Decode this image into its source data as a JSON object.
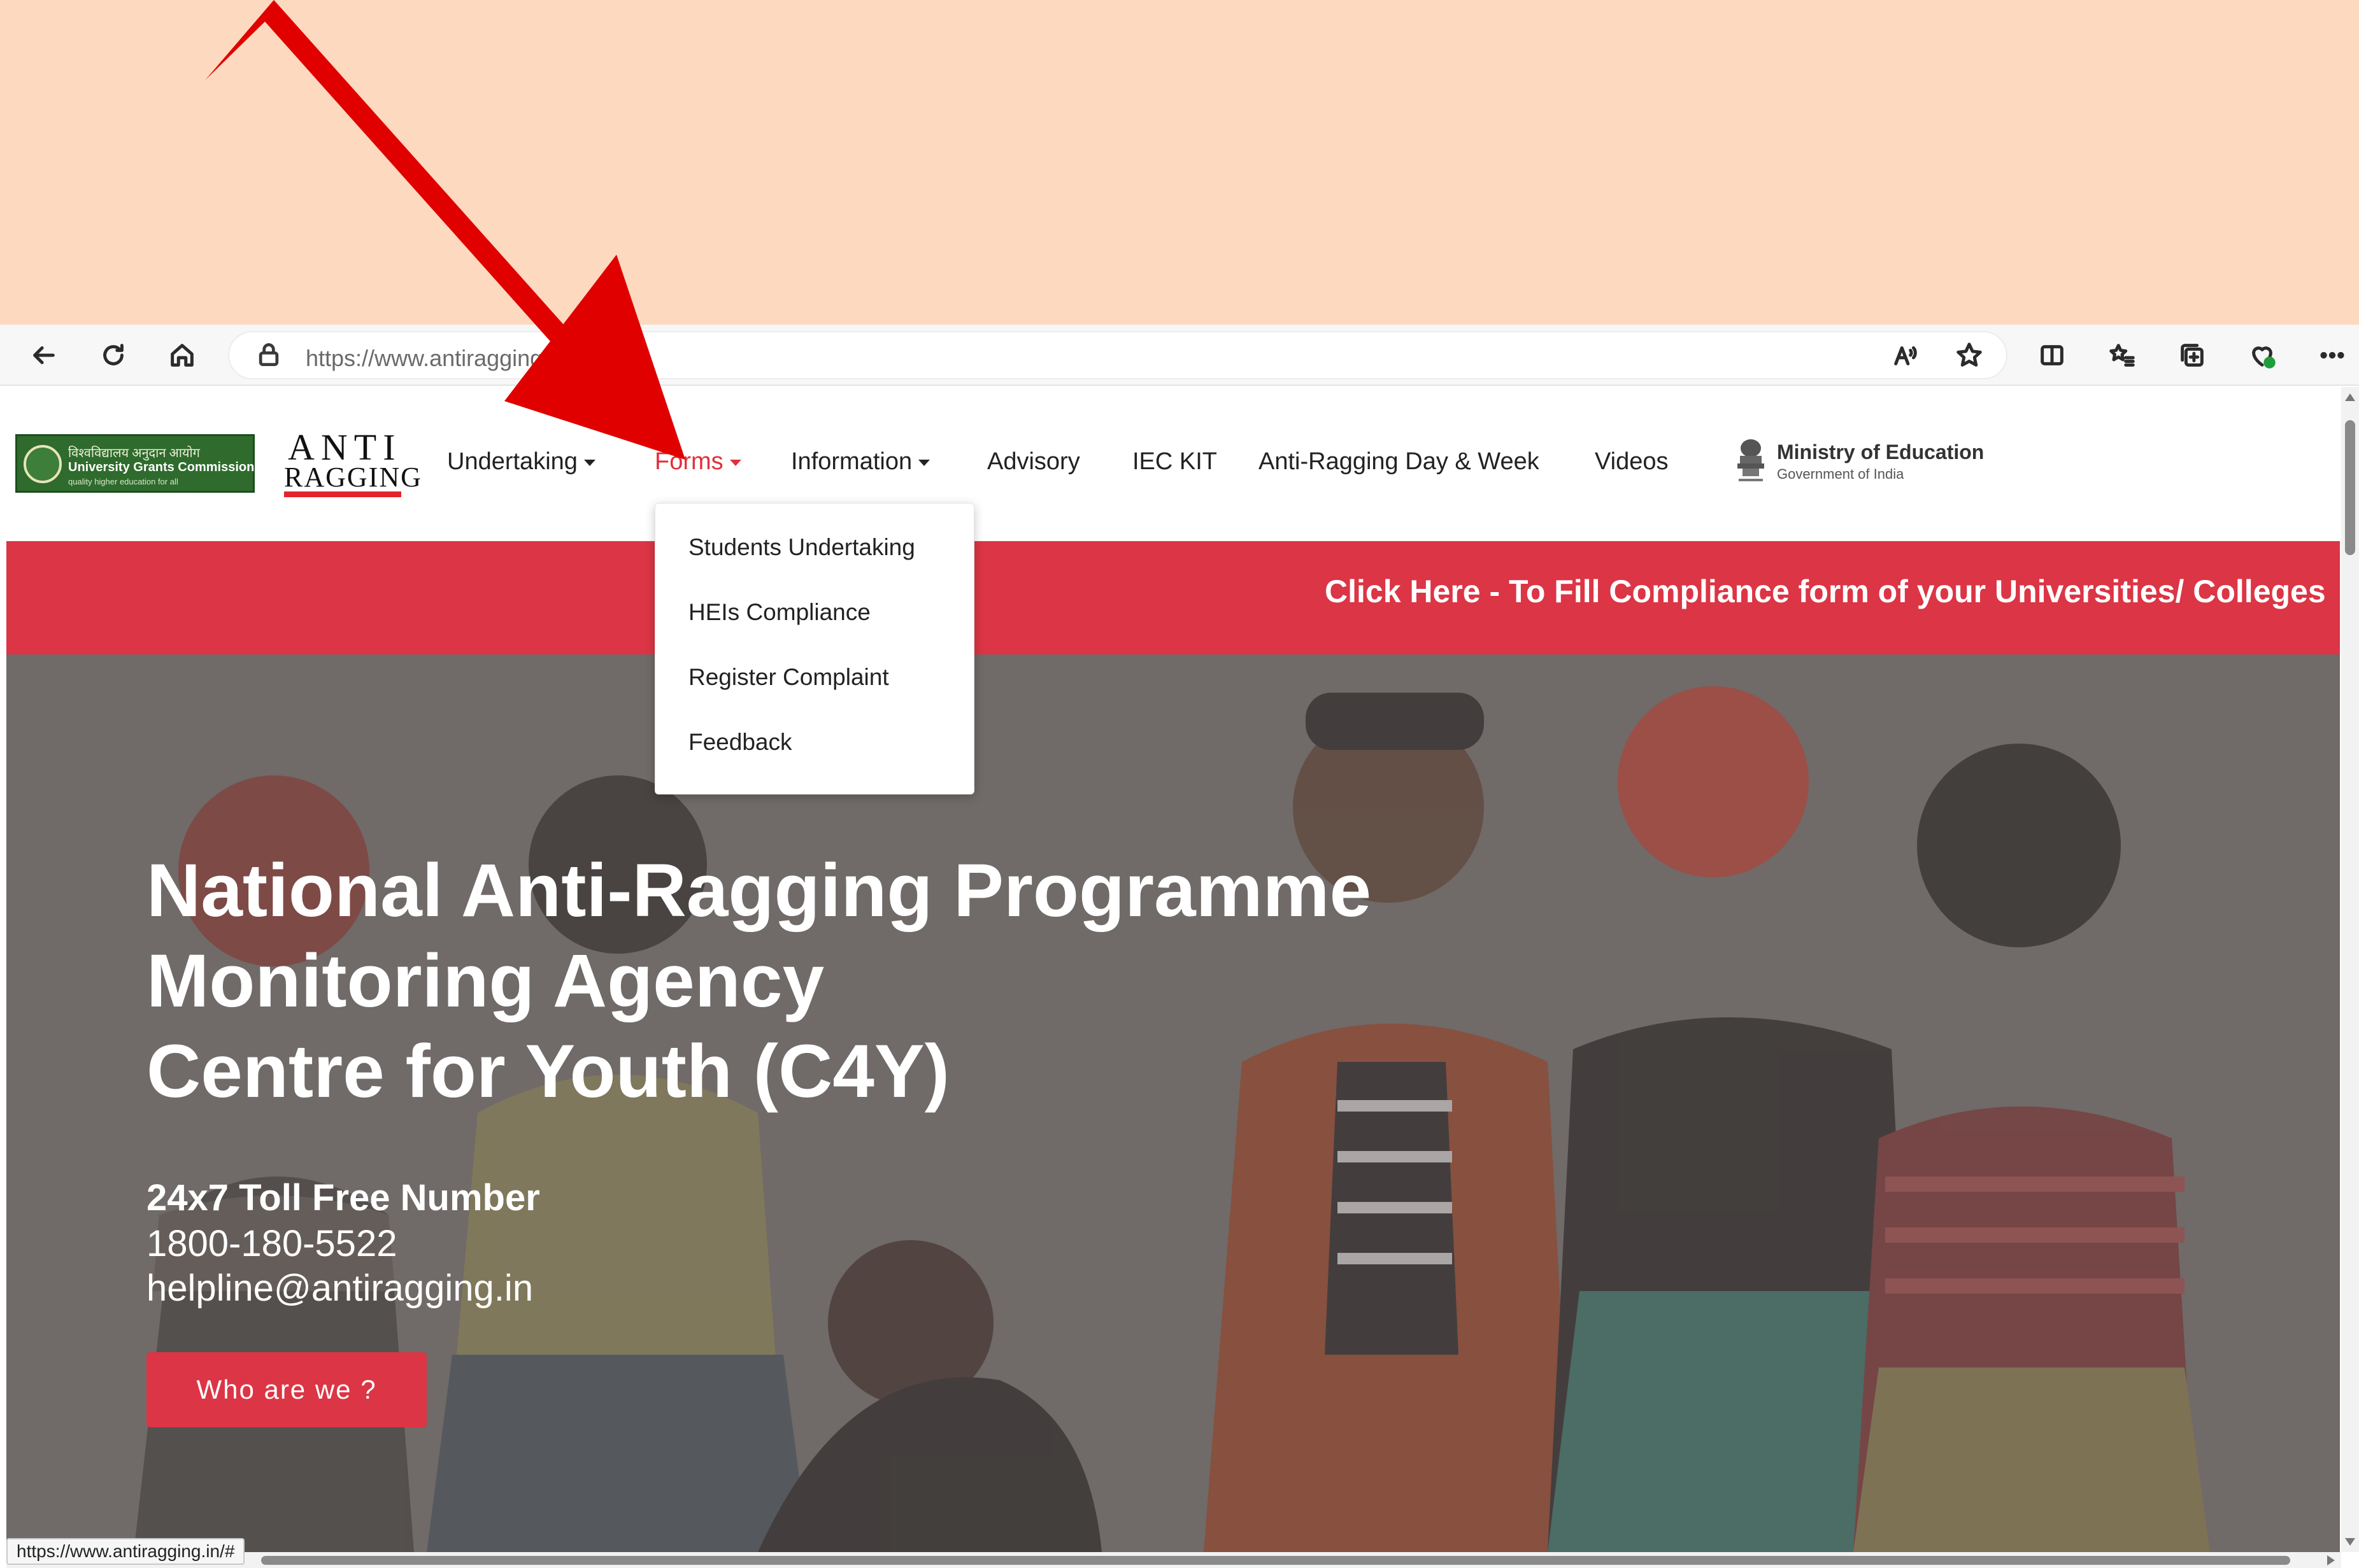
{
  "browser": {
    "url_main": "https://www.antiragging.",
    "url_rest": "in"
  },
  "site": {
    "ugc": {
      "hindi": "विश्वविद्यालय अनुदान आयोग",
      "name": "University Grants Commission",
      "tagline": "quality higher education for all"
    },
    "logo": {
      "top": "ANTI",
      "bottom": "RAGGING"
    },
    "nav": [
      {
        "label": "Undertaking",
        "dropdown": true
      },
      {
        "label": "Forms",
        "dropdown": true,
        "active": true
      },
      {
        "label": "Information",
        "dropdown": true
      },
      {
        "label": "Advisory"
      },
      {
        "label": "IEC KIT"
      },
      {
        "label": "Anti-Ragging Day & Week"
      },
      {
        "label": "Videos"
      }
    ],
    "ministry": {
      "title": "Ministry of Education",
      "subtitle": "Government of India"
    }
  },
  "forms_dropdown": [
    "Students Undertaking",
    "HEIs Compliance",
    "Register Complaint",
    "Feedback"
  ],
  "ticker": {
    "text": "Click Here - To Fill Compliance form of your Universities/ Colleges"
  },
  "hero": {
    "title_lines": [
      "National Anti-Ragging Programme",
      "Monitoring Agency",
      "Centre for Youth (C4Y)"
    ],
    "toll_label": "24x7 Toll Free Number",
    "toll_number": "1800-180-5522",
    "email": "helpline@antiragging.in",
    "button_label": "Who are we ?"
  },
  "status_bar": {
    "url": "https://www.antiragging.in/#"
  },
  "colors": {
    "accent_red": "#dc3545",
    "nav_active": "#e0303b",
    "annotation_arrow": "#e00000",
    "banner_bg": "#fdd9c0",
    "hero_bg": "#706a68"
  }
}
